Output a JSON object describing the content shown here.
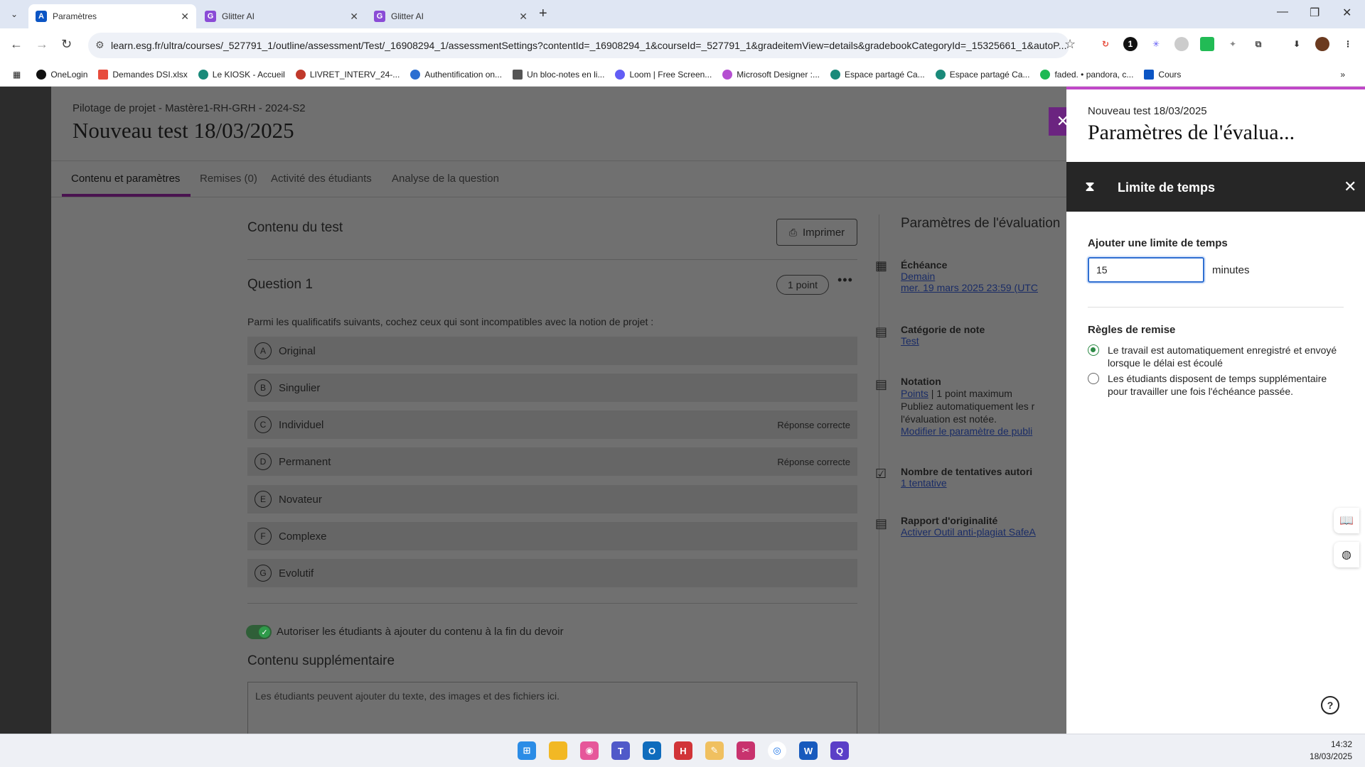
{
  "browser": {
    "tabs": [
      {
        "title": "Paramètres",
        "fav": "A",
        "fav_color": "#0b55c4",
        "active": true
      },
      {
        "title": "Glitter AI",
        "fav": "G",
        "fav_color": "#8a4bd6",
        "active": false
      },
      {
        "title": "Glitter AI",
        "fav": "G",
        "fav_color": "#8a4bd6",
        "active": false
      }
    ],
    "url": "learn.esg.fr/ultra/courses/_527791_1/outline/assessment/Test/_16908294_1/assessmentSettings?contentId=_16908294_1&courseId=_527791_1&gradeitemView=details&gradebookCategoryId=_15325661_1&autoP...",
    "bookmarks": [
      {
        "label": "OneLogin",
        "color": "#111"
      },
      {
        "label": "Demandes DSI.xlsx",
        "color": "#e74c3c"
      },
      {
        "label": "Le KIOSK - Accueil",
        "color": "#1a8a7a"
      },
      {
        "label": "LIVRET_INTERV_24-...",
        "color": "#c0392b"
      },
      {
        "label": "Authentification on...",
        "color": "#2c6fd1"
      },
      {
        "label": "Un bloc-notes en li...",
        "color": "#555"
      },
      {
        "label": "Loom | Free Screen...",
        "color": "#625df5"
      },
      {
        "label": "Microsoft Designer :...",
        "color": "#b54fd1"
      },
      {
        "label": "Espace partagé Ca...",
        "color": "#1a8a7a"
      },
      {
        "label": "Espace partagé Ca...",
        "color": "#1a8a7a"
      },
      {
        "label": "faded. • pandora, c...",
        "color": "#1db954"
      },
      {
        "label": "Cours",
        "color": "#0b55c4"
      }
    ]
  },
  "course": {
    "breadcrumb": "Pilotage de projet - Mastère1-RH-GRH - 2024-S2",
    "title": "Nouveau test 18/03/2025",
    "tabs": [
      "Contenu et paramètres",
      "Remises (0)",
      "Activité des étudiants",
      "Analyse de la question"
    ]
  },
  "test": {
    "content_title": "Contenu du test",
    "print_label": "Imprimer",
    "question_title": "Question 1",
    "points": "1  point",
    "prompt": "Parmi les qualificatifs suivants, cochez ceux qui sont incompatibles avec la notion de projet :",
    "answers": [
      {
        "letter": "A",
        "text": "Original",
        "correct": ""
      },
      {
        "letter": "B",
        "text": "Singulier",
        "correct": ""
      },
      {
        "letter": "C",
        "text": "Individuel",
        "correct": "Réponse correcte"
      },
      {
        "letter": "D",
        "text": "Permanent",
        "correct": "Réponse correcte"
      },
      {
        "letter": "E",
        "text": "Novateur",
        "correct": ""
      },
      {
        "letter": "F",
        "text": "Complexe",
        "correct": ""
      },
      {
        "letter": "G",
        "text": "Evolutif",
        "correct": ""
      }
    ],
    "allow_label": "Autoriser les étudiants à ajouter du contenu à la fin du devoir",
    "extra_title": "Contenu supplémentaire",
    "extra_placeholder": "Les étudiants peuvent ajouter du texte, des images et des fichiers ici."
  },
  "settings": {
    "title": "Paramètres de l'évaluation",
    "due_label": "Échéance",
    "due_link": "Demain",
    "due_date": "mer. 19 mars 2025 23:59 (UTC",
    "cat_label": "Catégorie de note",
    "cat_value": "Test",
    "notation_label": "Notation",
    "notation_points": "Points",
    "notation_max": " | 1 point maximum",
    "notation_text1": "Publiez automatiquement les r",
    "notation_text2": "l'évaluation est notée.",
    "notation_link": "Modifier le paramètre de publi",
    "attempts_label": "Nombre de tentatives autori",
    "attempts_value": "1 tentative",
    "orig_label": "Rapport d'originalité",
    "orig_value": "Activer Outil anti-plagiat SafeA"
  },
  "panel": {
    "subtitle": "Nouveau test 18/03/2025",
    "title": "Paramètres de l'évalua...",
    "header": "Limite de temps",
    "limit_label": "Ajouter une limite de temps",
    "limit_value": "15",
    "unit": "minutes",
    "rules_label": "Règles de remise",
    "rule1": "Le travail est automatiquement enregistré et envoyé lorsque le délai est écoulé",
    "rule2": "Les étudiants disposent de temps supplémentaire pour travailler une fois l'échéance passée."
  },
  "clock": {
    "time": "14:32",
    "date": "18/03/2025"
  }
}
